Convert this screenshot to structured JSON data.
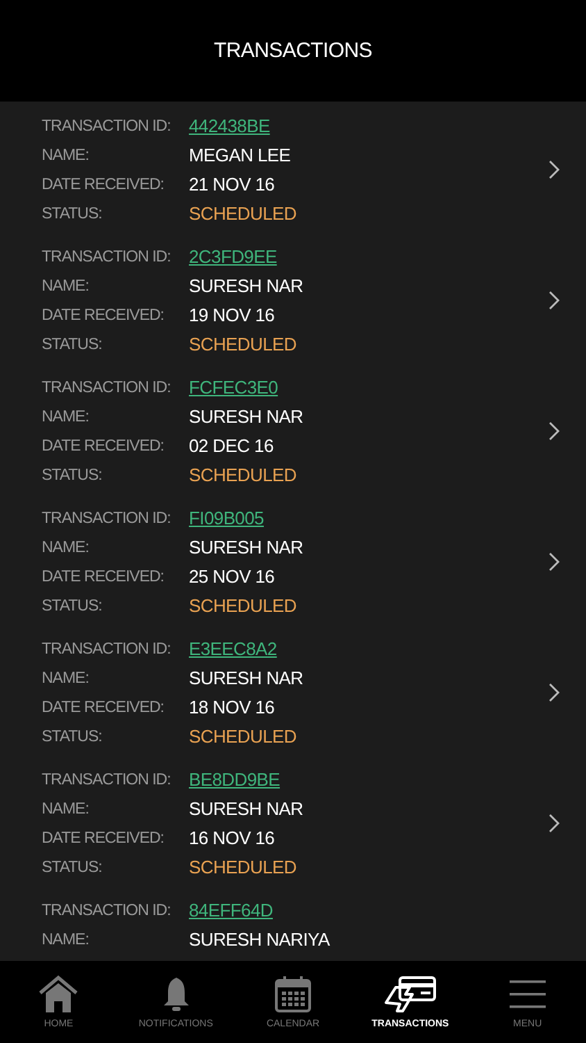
{
  "header": {
    "title": "TRANSACTIONS"
  },
  "transactions": [
    {
      "fields": [
        {
          "label": "TRANSACTION ID:",
          "value": "442438BE",
          "kind": "link"
        },
        {
          "label": "NAME:",
          "value": "MEGAN LEE",
          "kind": "text"
        },
        {
          "label": "DATE RECEIVED:",
          "value": "21 NOV 16",
          "kind": "text"
        },
        {
          "label": "STATUS:",
          "value": "SCHEDULED",
          "kind": "status"
        }
      ]
    },
    {
      "fields": [
        {
          "label": "TRANSACTION ID:",
          "value": "2C3FD9EE",
          "kind": "link"
        },
        {
          "label": "NAME:",
          "value": "SURESH NAR",
          "kind": "text"
        },
        {
          "label": "DATE RECEIVED:",
          "value": "19 NOV 16",
          "kind": "text"
        },
        {
          "label": "STATUS:",
          "value": "SCHEDULED",
          "kind": "status"
        }
      ]
    },
    {
      "fields": [
        {
          "label": "TRANSACTION ID:",
          "value": "FCFEC3E0",
          "kind": "link"
        },
        {
          "label": "NAME:",
          "value": "SURESH NAR",
          "kind": "text"
        },
        {
          "label": "DATE RECEIVED:",
          "value": "02 DEC 16",
          "kind": "text"
        },
        {
          "label": "STATUS:",
          "value": "SCHEDULED",
          "kind": "status"
        }
      ]
    },
    {
      "fields": [
        {
          "label": "TRANSACTION ID:",
          "value": "FI09B005",
          "kind": "link"
        },
        {
          "label": "NAME:",
          "value": "SURESH NAR",
          "kind": "text"
        },
        {
          "label": "DATE RECEIVED:",
          "value": "25 NOV 16",
          "kind": "text"
        },
        {
          "label": "STATUS:",
          "value": "SCHEDULED",
          "kind": "status"
        }
      ]
    },
    {
      "fields": [
        {
          "label": "TRANSACTION ID:",
          "value": "E3EEC8A2",
          "kind": "link"
        },
        {
          "label": "NAME:",
          "value": "SURESH NAR",
          "kind": "text"
        },
        {
          "label": "DATE RECEIVED:",
          "value": "18 NOV 16",
          "kind": "text"
        },
        {
          "label": "STATUS:",
          "value": "SCHEDULED",
          "kind": "status"
        }
      ]
    },
    {
      "fields": [
        {
          "label": "TRANSACTION ID:",
          "value": "BE8DD9BE",
          "kind": "link"
        },
        {
          "label": "NAME:",
          "value": "SURESH NAR",
          "kind": "text"
        },
        {
          "label": "DATE RECEIVED:",
          "value": "16 NOV 16",
          "kind": "text"
        },
        {
          "label": "STATUS:",
          "value": "SCHEDULED",
          "kind": "status"
        }
      ]
    },
    {
      "fields": [
        {
          "label": "TRANSACTION ID:",
          "value": "84EFF64D",
          "kind": "link"
        },
        {
          "label": "NAME:",
          "value": "SURESH NARIYA",
          "kind": "text"
        }
      ]
    }
  ],
  "tab_bar": [
    {
      "label": "HOME",
      "kind": "home",
      "selected": false
    },
    {
      "label": "NOTIFICATIONS",
      "kind": "bell",
      "selected": false
    },
    {
      "label": "CALENDAR",
      "kind": "calendar",
      "selected": false
    },
    {
      "label": "TRANSACTIONS",
      "kind": "card",
      "selected": true
    },
    {
      "label": "MENU",
      "kind": "menu",
      "selected": false
    }
  ]
}
